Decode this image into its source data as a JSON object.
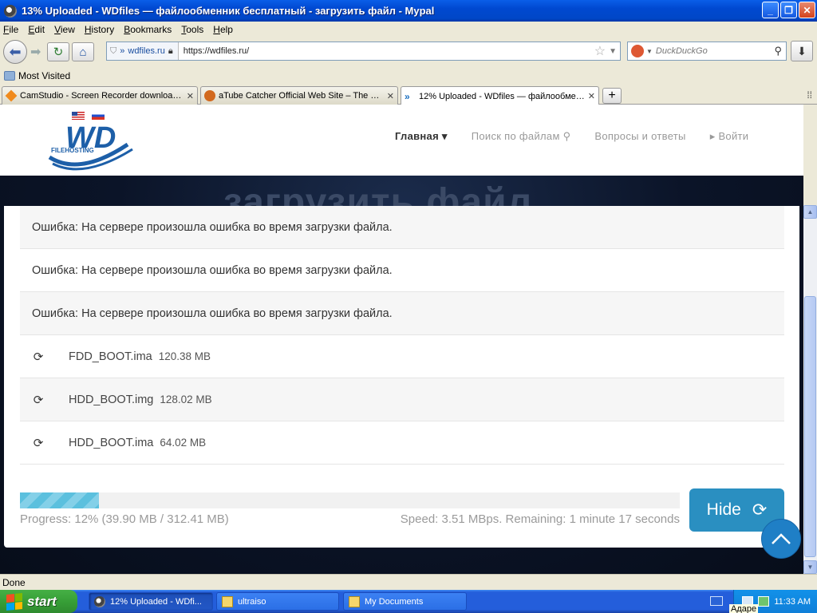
{
  "window": {
    "title": "13% Uploaded - WDfiles — файлообменник бесплатный - загрузить файл - Mypal",
    "controls": [
      "_",
      "❐",
      "✕"
    ]
  },
  "menu": [
    "File",
    "Edit",
    "View",
    "History",
    "Bookmarks",
    "Tools",
    "Help"
  ],
  "navbar": {
    "identity": "wdfiles.ru",
    "url": "https://wdfiles.ru/",
    "search_engine": "DuckDuckGo"
  },
  "bookmarks": {
    "most_visited": "Most Visited"
  },
  "tabs": [
    {
      "label": "CamStudio - Screen Recorder download |...",
      "icon": "camstudio-icon"
    },
    {
      "label": "aTube Catcher Official Web Site – The be...",
      "icon": "atube-icon"
    },
    {
      "label": "12% Uploaded - WDfiles — файлообмен...",
      "icon": "wdfiles-icon",
      "active": true
    }
  ],
  "site": {
    "logo_text": "WD",
    "logo_sub": "FILEHOSTING",
    "nav": [
      "Главная ▾",
      "Поиск по файлам ⚲",
      "Вопросы и ответы",
      "▸ Войти"
    ],
    "hero_title": "загрузить файл"
  },
  "upload": {
    "errors": [
      "Ошибка: На сервере произошла ошибка во время загрузки файла.",
      "Ошибка: На сервере произошла ошибка во время загрузки файла.",
      "Ошибка: На сервере произошла ошибка во время загрузки файла."
    ],
    "files": [
      {
        "name": "FDD_BOOT.ima",
        "size": "120.38 MB"
      },
      {
        "name": "HDD_BOOT.img",
        "size": "128.02 MB"
      },
      {
        "name": "HDD_BOOT.ima",
        "size": "64.02 MB"
      }
    ],
    "progress_percent": 12,
    "progress_text": "Progress: 12% (39.90 MB / 312.41 MB)",
    "speed_text": "Speed: 3.51 MBps. Remaining: 1 minute 17 seconds",
    "hide_label": "Hide"
  },
  "status": "Done",
  "taskbar": {
    "start": "start",
    "tasks": [
      {
        "label": "12% Uploaded - WDfi...",
        "active": true
      },
      {
        "label": "ultraiso",
        "active": false
      },
      {
        "label": "My Documents",
        "active": false
      }
    ],
    "clock": "11:33 AM",
    "tooltip": "Адаре"
  },
  "colors": {
    "accent": "#2a8fc1",
    "progress": "#5bc0de",
    "titlebar": "#0048d0",
    "taskbar": "#245edb",
    "start": "#379f37"
  }
}
